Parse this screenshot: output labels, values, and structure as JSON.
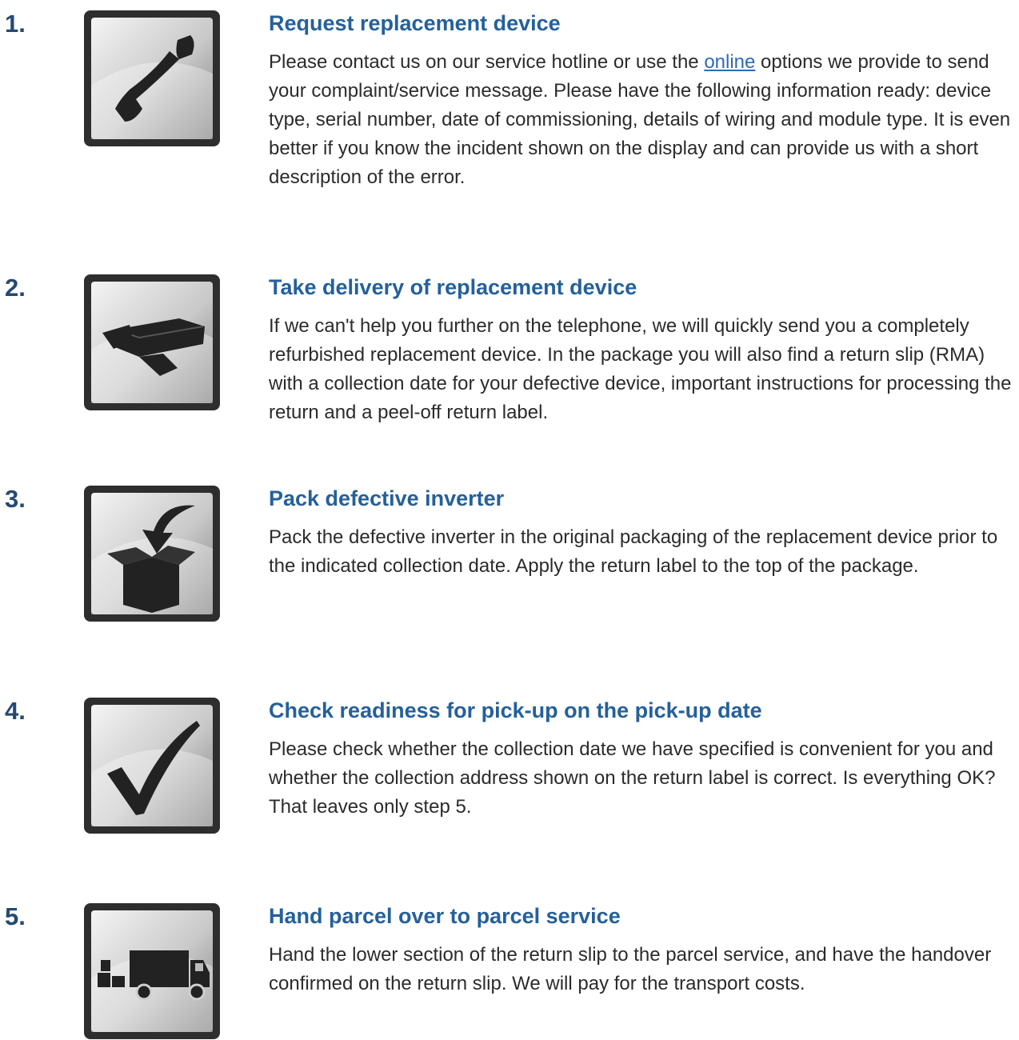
{
  "steps": [
    {
      "number": "1.",
      "title": "Request replacement device",
      "text_before": "Please contact us on our service hotline or use the ",
      "link_text": "online",
      "text_after": " options we provide to send your complaint/service message. Please have the following information ready: device type, serial number, date of commissioning, details of wiring and module type. It is even better if you know the incident shown on the display and can provide us with a short description of the error.",
      "icon": "telephone-handset-icon"
    },
    {
      "number": "2.",
      "title": "Take delivery of replacement device",
      "text": "If we can't help you further on the telephone, we will quickly send you a completely refurbished replacement device. In the package you will also find a return slip (RMA) with a collection date for your defective device, important instructions for processing the return and a peel-off return label.",
      "icon": "hands-delivering-box-icon"
    },
    {
      "number": "3.",
      "title": "Pack defective inverter",
      "text": "Pack the defective inverter in the original packaging of the replacement device prior to the indicated collection date. Apply the return label to the top of the package.",
      "icon": "box-with-arrow-icon"
    },
    {
      "number": "4.",
      "title": "Check readiness for pick-up on the pick-up date",
      "text": "Please check whether the collection date we have specified is convenient for you and whether the collection address shown on the return label is correct. Is everything OK? That leaves only step 5.",
      "icon": "checkmark-icon"
    },
    {
      "number": "5.",
      "title": "Hand parcel over to parcel service",
      "text": "Hand the lower section of the return slip to the parcel service, and have the handover confirmed on the return slip. We will pay for the transport costs.",
      "icon": "delivery-truck-icon"
    }
  ],
  "colors": {
    "number": "#244a72",
    "title": "#25609a",
    "body_text": "#2b2b2b",
    "link": "#2a6db5",
    "tile_frame": "#2e2e2e"
  }
}
